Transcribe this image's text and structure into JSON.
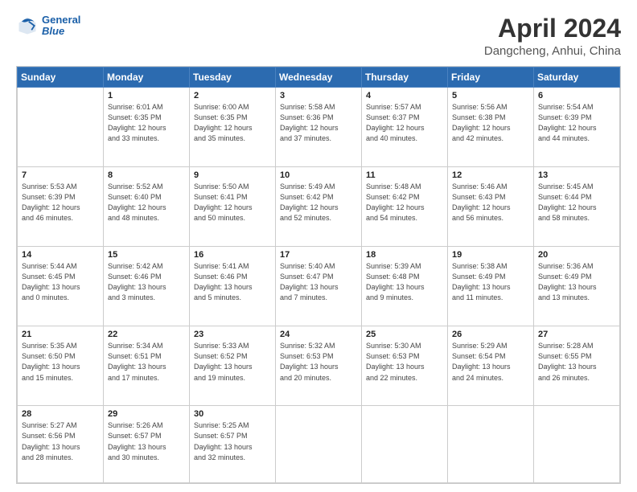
{
  "header": {
    "logo_line1": "General",
    "logo_line2": "Blue",
    "title": "April 2024",
    "subtitle": "Dangcheng, Anhui, China"
  },
  "calendar": {
    "weekdays": [
      "Sunday",
      "Monday",
      "Tuesday",
      "Wednesday",
      "Thursday",
      "Friday",
      "Saturday"
    ],
    "weeks": [
      [
        {
          "day": "",
          "info": ""
        },
        {
          "day": "1",
          "info": "Sunrise: 6:01 AM\nSunset: 6:35 PM\nDaylight: 12 hours\nand 33 minutes."
        },
        {
          "day": "2",
          "info": "Sunrise: 6:00 AM\nSunset: 6:35 PM\nDaylight: 12 hours\nand 35 minutes."
        },
        {
          "day": "3",
          "info": "Sunrise: 5:58 AM\nSunset: 6:36 PM\nDaylight: 12 hours\nand 37 minutes."
        },
        {
          "day": "4",
          "info": "Sunrise: 5:57 AM\nSunset: 6:37 PM\nDaylight: 12 hours\nand 40 minutes."
        },
        {
          "day": "5",
          "info": "Sunrise: 5:56 AM\nSunset: 6:38 PM\nDaylight: 12 hours\nand 42 minutes."
        },
        {
          "day": "6",
          "info": "Sunrise: 5:54 AM\nSunset: 6:39 PM\nDaylight: 12 hours\nand 44 minutes."
        }
      ],
      [
        {
          "day": "7",
          "info": "Sunrise: 5:53 AM\nSunset: 6:39 PM\nDaylight: 12 hours\nand 46 minutes."
        },
        {
          "day": "8",
          "info": "Sunrise: 5:52 AM\nSunset: 6:40 PM\nDaylight: 12 hours\nand 48 minutes."
        },
        {
          "day": "9",
          "info": "Sunrise: 5:50 AM\nSunset: 6:41 PM\nDaylight: 12 hours\nand 50 minutes."
        },
        {
          "day": "10",
          "info": "Sunrise: 5:49 AM\nSunset: 6:42 PM\nDaylight: 12 hours\nand 52 minutes."
        },
        {
          "day": "11",
          "info": "Sunrise: 5:48 AM\nSunset: 6:42 PM\nDaylight: 12 hours\nand 54 minutes."
        },
        {
          "day": "12",
          "info": "Sunrise: 5:46 AM\nSunset: 6:43 PM\nDaylight: 12 hours\nand 56 minutes."
        },
        {
          "day": "13",
          "info": "Sunrise: 5:45 AM\nSunset: 6:44 PM\nDaylight: 12 hours\nand 58 minutes."
        }
      ],
      [
        {
          "day": "14",
          "info": "Sunrise: 5:44 AM\nSunset: 6:45 PM\nDaylight: 13 hours\nand 0 minutes."
        },
        {
          "day": "15",
          "info": "Sunrise: 5:42 AM\nSunset: 6:46 PM\nDaylight: 13 hours\nand 3 minutes."
        },
        {
          "day": "16",
          "info": "Sunrise: 5:41 AM\nSunset: 6:46 PM\nDaylight: 13 hours\nand 5 minutes."
        },
        {
          "day": "17",
          "info": "Sunrise: 5:40 AM\nSunset: 6:47 PM\nDaylight: 13 hours\nand 7 minutes."
        },
        {
          "day": "18",
          "info": "Sunrise: 5:39 AM\nSunset: 6:48 PM\nDaylight: 13 hours\nand 9 minutes."
        },
        {
          "day": "19",
          "info": "Sunrise: 5:38 AM\nSunset: 6:49 PM\nDaylight: 13 hours\nand 11 minutes."
        },
        {
          "day": "20",
          "info": "Sunrise: 5:36 AM\nSunset: 6:49 PM\nDaylight: 13 hours\nand 13 minutes."
        }
      ],
      [
        {
          "day": "21",
          "info": "Sunrise: 5:35 AM\nSunset: 6:50 PM\nDaylight: 13 hours\nand 15 minutes."
        },
        {
          "day": "22",
          "info": "Sunrise: 5:34 AM\nSunset: 6:51 PM\nDaylight: 13 hours\nand 17 minutes."
        },
        {
          "day": "23",
          "info": "Sunrise: 5:33 AM\nSunset: 6:52 PM\nDaylight: 13 hours\nand 19 minutes."
        },
        {
          "day": "24",
          "info": "Sunrise: 5:32 AM\nSunset: 6:53 PM\nDaylight: 13 hours\nand 20 minutes."
        },
        {
          "day": "25",
          "info": "Sunrise: 5:30 AM\nSunset: 6:53 PM\nDaylight: 13 hours\nand 22 minutes."
        },
        {
          "day": "26",
          "info": "Sunrise: 5:29 AM\nSunset: 6:54 PM\nDaylight: 13 hours\nand 24 minutes."
        },
        {
          "day": "27",
          "info": "Sunrise: 5:28 AM\nSunset: 6:55 PM\nDaylight: 13 hours\nand 26 minutes."
        }
      ],
      [
        {
          "day": "28",
          "info": "Sunrise: 5:27 AM\nSunset: 6:56 PM\nDaylight: 13 hours\nand 28 minutes."
        },
        {
          "day": "29",
          "info": "Sunrise: 5:26 AM\nSunset: 6:57 PM\nDaylight: 13 hours\nand 30 minutes."
        },
        {
          "day": "30",
          "info": "Sunrise: 5:25 AM\nSunset: 6:57 PM\nDaylight: 13 hours\nand 32 minutes."
        },
        {
          "day": "",
          "info": ""
        },
        {
          "day": "",
          "info": ""
        },
        {
          "day": "",
          "info": ""
        },
        {
          "day": "",
          "info": ""
        }
      ]
    ]
  }
}
